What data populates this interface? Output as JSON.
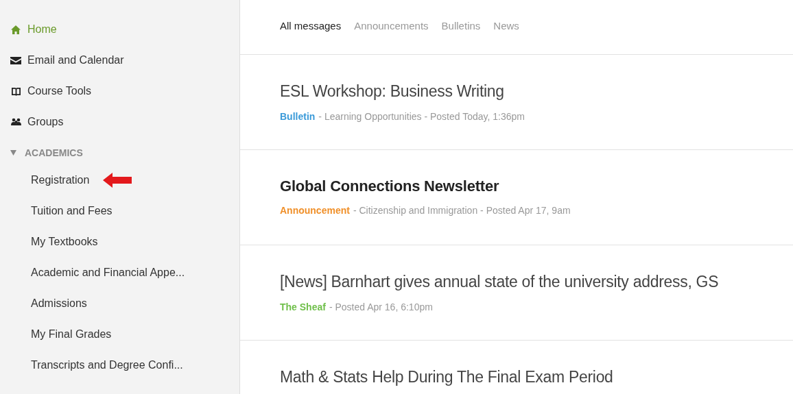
{
  "sidebar": {
    "items": [
      {
        "label": "Home",
        "kind": "home",
        "selected": true
      },
      {
        "label": "Email and Calendar",
        "kind": "mail",
        "selected": false
      },
      {
        "label": "Course Tools",
        "kind": "book",
        "selected": false
      },
      {
        "label": "Groups",
        "kind": "users",
        "selected": false
      }
    ],
    "section": {
      "label": "ACADEMICS",
      "expanded": true,
      "children": [
        {
          "label": "Registration",
          "selected": false,
          "pointer_arrow": true
        },
        {
          "label": "Tuition and Fees",
          "selected": false,
          "pointer_arrow": false
        },
        {
          "label": "My Textbooks",
          "selected": false,
          "pointer_arrow": false
        },
        {
          "label": "Academic and Financial Appe...",
          "selected": false,
          "pointer_arrow": false
        },
        {
          "label": "Admissions",
          "selected": false,
          "pointer_arrow": false
        },
        {
          "label": "My Final Grades",
          "selected": false,
          "pointer_arrow": false
        },
        {
          "label": "Transcripts and Degree Confi...",
          "selected": false,
          "pointer_arrow": false
        }
      ]
    }
  },
  "tabs": [
    {
      "label": "All messages",
      "selected": true
    },
    {
      "label": "Announcements",
      "selected": false
    },
    {
      "label": "Bulletins",
      "selected": false
    },
    {
      "label": "News",
      "selected": false
    }
  ],
  "messages": [
    {
      "title": "ESL Workshop: Business Writing",
      "unread": false,
      "source": "Bulletin",
      "color": "#3a9ad9",
      "details": "- Learning Opportunities - Posted Today, 1:36pm"
    },
    {
      "title": "Global Connections Newsletter",
      "unread": true,
      "source": "Announcement",
      "color": "#f0902a",
      "details": "- Citizenship and Immigration - Posted Apr 17, 9am"
    },
    {
      "title": "[News] Barnhart gives annual state of the university address, GS",
      "unread": false,
      "source": "The Sheaf",
      "color": "#6fbf4a",
      "details": "- Posted Apr 16, 6:10pm"
    },
    {
      "title": "Math & Stats Help During The Final Exam Period",
      "unread": false
    }
  ]
}
